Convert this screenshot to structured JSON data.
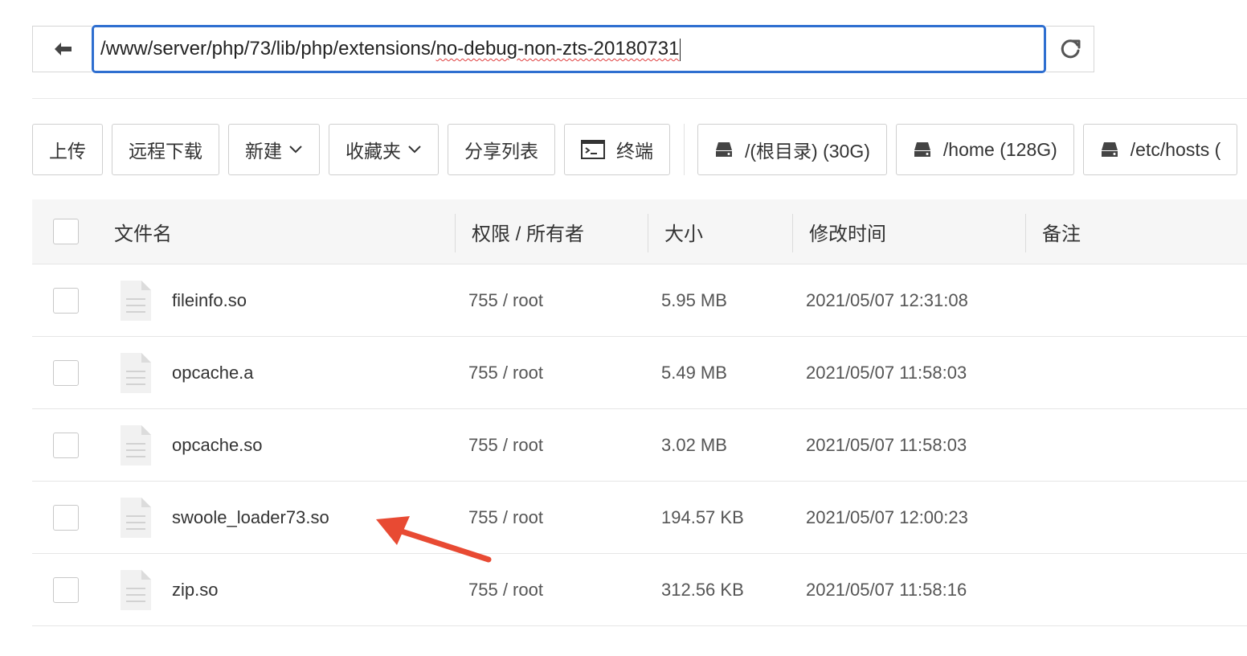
{
  "address": {
    "path_prefix": "/www/server/php/73/lib/php/extensions/",
    "path_underlined": "no-debug-non-zts-20180731"
  },
  "toolbar": {
    "upload": "上传",
    "remote_download": "远程下载",
    "new": "新建",
    "favorites": "收藏夹",
    "share_list": "分享列表",
    "terminal": "终端",
    "disks": [
      {
        "label": "/(根目录) (30G)"
      },
      {
        "label": "/home (128G)"
      },
      {
        "label": "/etc/hosts ("
      }
    ]
  },
  "table": {
    "headers": {
      "name": "文件名",
      "perm": "权限 / 所有者",
      "size": "大小",
      "mtime": "修改时间",
      "note": "备注"
    },
    "rows": [
      {
        "name": "fileinfo.so",
        "perm": "755 / root",
        "size": "5.95 MB",
        "mtime": "2021/05/07 12:31:08"
      },
      {
        "name": "opcache.a",
        "perm": "755 / root",
        "size": "5.49 MB",
        "mtime": "2021/05/07 11:58:03"
      },
      {
        "name": "opcache.so",
        "perm": "755 / root",
        "size": "3.02 MB",
        "mtime": "2021/05/07 11:58:03"
      },
      {
        "name": "swoole_loader73.so",
        "perm": "755 / root",
        "size": "194.57 KB",
        "mtime": "2021/05/07 12:00:23"
      },
      {
        "name": "zip.so",
        "perm": "755 / root",
        "size": "312.56 KB",
        "mtime": "2021/05/07 11:58:16"
      }
    ]
  },
  "icons": {
    "back": "arrow-left-icon",
    "refresh": "refresh-icon",
    "terminal": "terminal-icon",
    "disk": "disk-icon",
    "file": "file-icon",
    "chevron": "chevron-down-icon"
  },
  "colors": {
    "input_border": "#2f6fd0",
    "annotation_arrow": "#e84a33"
  }
}
